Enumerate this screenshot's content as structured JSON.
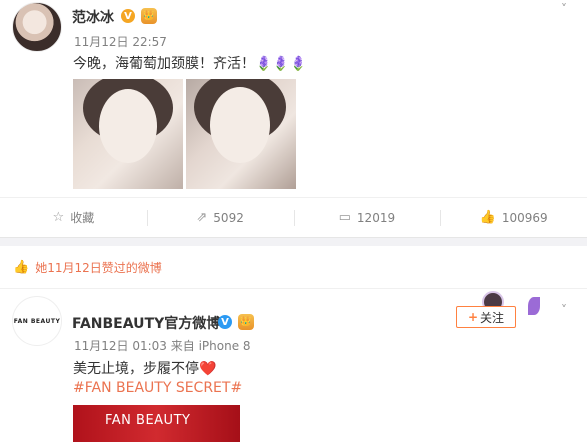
{
  "post1": {
    "user": "范冰冰",
    "verified_mark": "V",
    "medal_mark": "👑",
    "time": "11月12日 22:57",
    "text": "今晚，海葡萄加颈膜！齐活！🪻🪻🪻",
    "actions": {
      "favorite": "收藏",
      "repost": "5092",
      "comment": "12019",
      "like": "100969"
    }
  },
  "liked_banner": "她11月12日赞过的微博",
  "post2": {
    "user": "FANBEAUTY官方微博",
    "avatar_text": "FAN BEAUTY",
    "verified_mark": "V",
    "medal_mark": "👑",
    "meta": "11月12日 01:03 来自 iPhone 8",
    "text": "美无止境，步履不停❤️",
    "hashtag": "#FAN BEAUTY SECRET#",
    "follow_label": "关注",
    "follow_plus": "+",
    "promo_text": "FAN BEAUTY"
  },
  "icons": {
    "chevron": "˅",
    "star": "☆",
    "repost": "⇗",
    "comment": "▭",
    "thumb": "👍"
  },
  "colors": {
    "accent": "#eb7350",
    "muted": "#808080",
    "follow_border": "#ff8140"
  }
}
